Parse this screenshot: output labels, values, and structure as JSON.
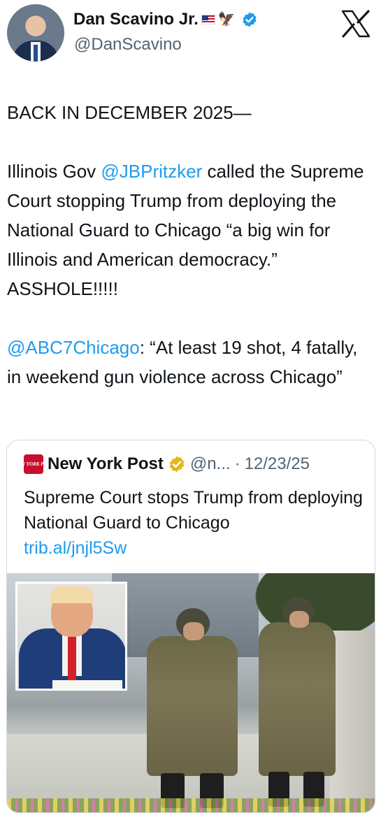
{
  "author": {
    "display_name": "Dan Scavino Jr.",
    "handle": "@DanScavino"
  },
  "tweet": {
    "line1": "BACK IN DECEMBER 2025—",
    "p2_prefix": "Illinois Gov ",
    "p2_mention": "@JBPritzker",
    "p2_rest": " called the Supreme Court stopping Trump from deploying the National Guard to Chicago “a big win for Illinois and American democracy.” ASSHOLE!!!!!",
    "p3_mention": "@ABC7Chicago",
    "p3_rest": ": “At least 19 shot, 4 fatally, in weekend gun violence across Chicago”"
  },
  "quote": {
    "logo_text": "NEW YORK POST",
    "source_name": "New York Post",
    "handle": "@n...",
    "separator": "·",
    "date": "12/23/25",
    "headline": "Supreme Court stops Trump from deploying National Guard to Chicago",
    "link": "trib.al/jnjl5Sw"
  },
  "icons": {
    "verified": "verified-badge-icon",
    "x_logo": "x-logo-icon",
    "gold_check": "gold-verified-icon"
  },
  "colors": {
    "link": "#1d9bf0",
    "verified_blue": "#1d9bf0",
    "gold": "#e2b719",
    "nyp_red": "#c8102e"
  }
}
